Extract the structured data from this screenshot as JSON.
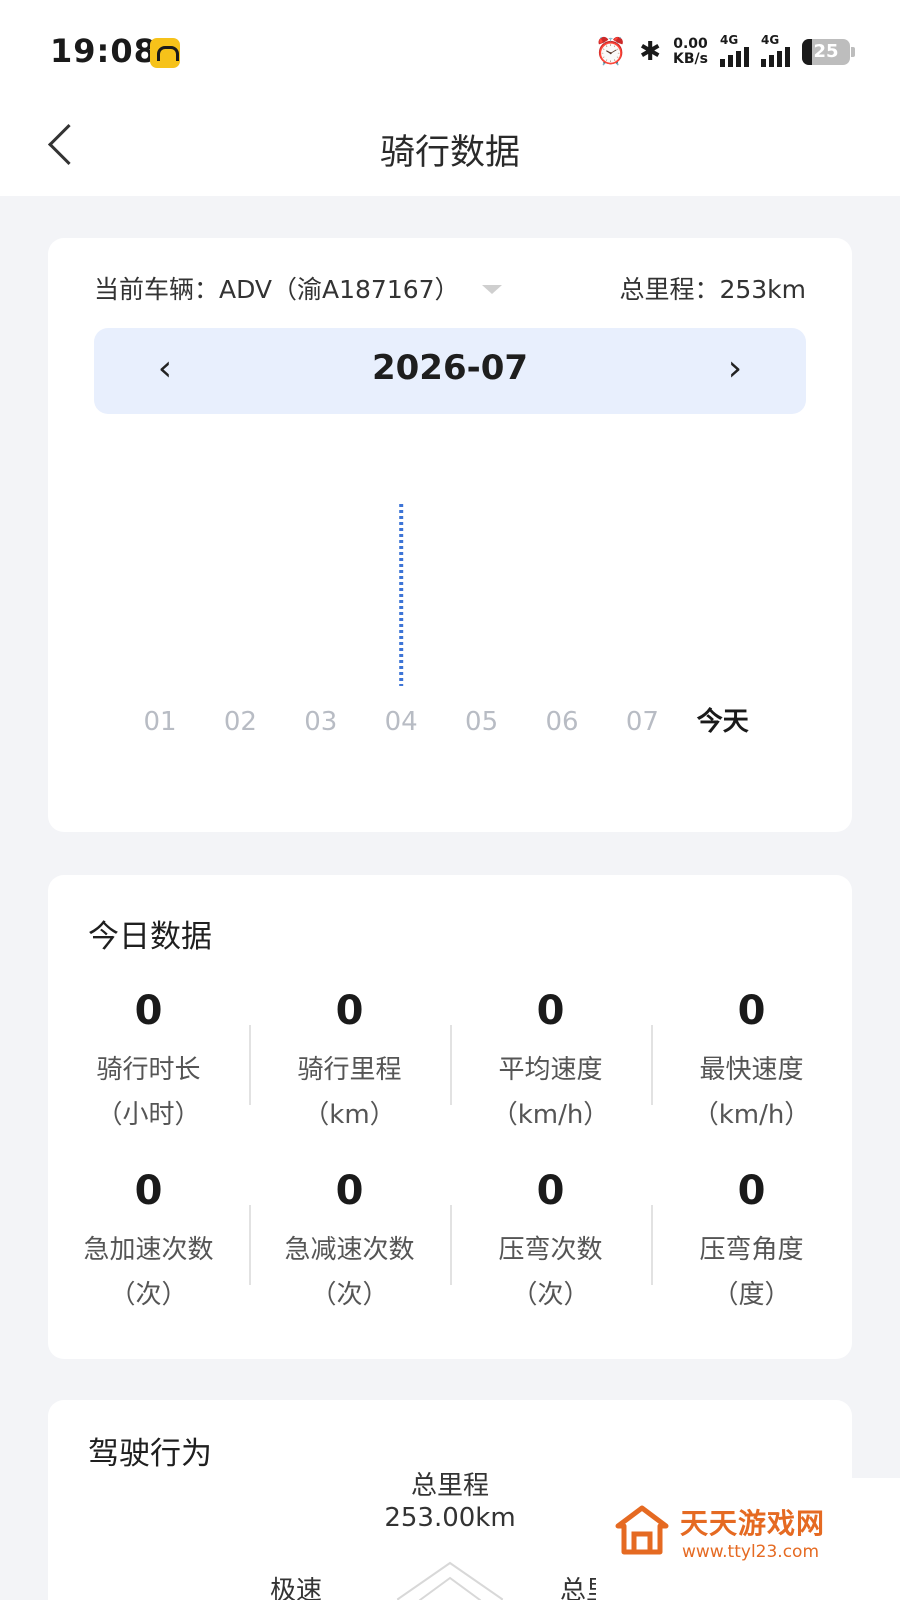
{
  "status": {
    "time": "19:08",
    "net_speed_value": "0.00",
    "net_speed_unit": "KB/s",
    "sim1_label": "4G",
    "sim2_label": "4G",
    "battery": "25"
  },
  "header": {
    "title": "骑行数据",
    "back_icon": "chevron-left-icon"
  },
  "vehicle": {
    "label": "当前车辆：ADV（渝A187167）",
    "total_label": "总里程：253km"
  },
  "month": {
    "label": "2026-07",
    "prev": "‹",
    "next": "›"
  },
  "chart_data": {
    "type": "bar",
    "categories": [
      "01",
      "02",
      "03",
      "04",
      "05",
      "06",
      "07",
      "今天"
    ],
    "values": [
      0,
      0,
      0,
      null,
      0,
      0,
      0,
      0
    ],
    "highlight_category": "04",
    "highlight_style": "dotted-line",
    "title": "",
    "xlabel": "",
    "ylabel": "",
    "today_label": "今天",
    "accent_color": "#3d74d6"
  },
  "today": {
    "title": "今日数据",
    "stats": [
      [
        {
          "value": "0",
          "label": "骑行时长",
          "unit": "（小时）"
        },
        {
          "value": "0",
          "label": "骑行里程",
          "unit": "（km）"
        },
        {
          "value": "0",
          "label": "平均速度",
          "unit": "（km/h）"
        },
        {
          "value": "0",
          "label": "最快速度",
          "unit": "（km/h）"
        }
      ],
      [
        {
          "value": "0",
          "label": "急加速次数",
          "unit": "（次）"
        },
        {
          "value": "0",
          "label": "急减速次数",
          "unit": "（次）"
        },
        {
          "value": "0",
          "label": "压弯次数",
          "unit": "（次）"
        },
        {
          "value": "0",
          "label": "压弯角度",
          "unit": "（度）"
        }
      ]
    ]
  },
  "behavior": {
    "title": "驾驶行为",
    "top_label": "总里程",
    "top_value": "253.00km",
    "left_label": "极速",
    "right_label": "总里"
  },
  "watermark": {
    "name": "天天游戏网",
    "url": "www.ttyl23.com",
    "color": "#e56a22"
  }
}
